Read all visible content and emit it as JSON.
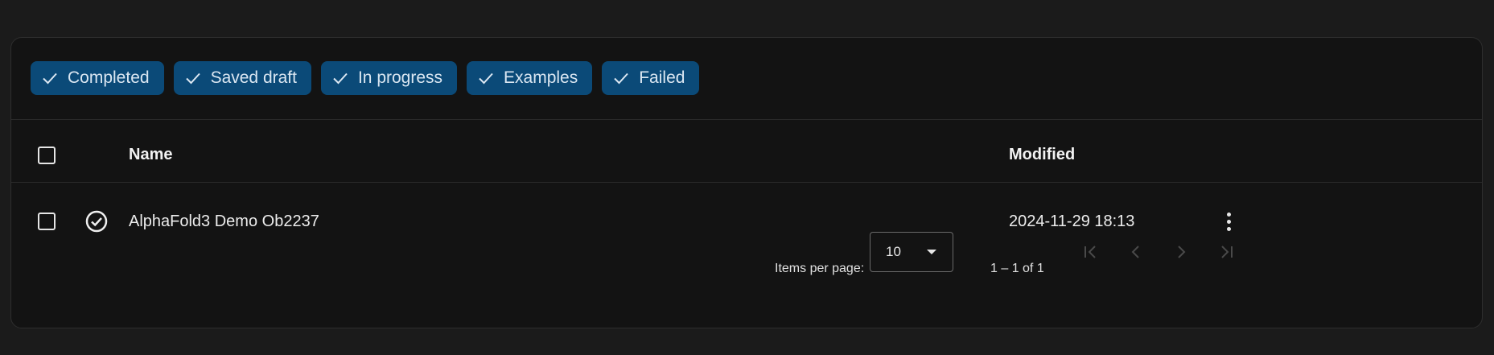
{
  "filters": [
    {
      "label": "Completed",
      "icon": "check-icon"
    },
    {
      "label": "Saved draft",
      "icon": "check-icon"
    },
    {
      "label": "In progress",
      "icon": "check-icon"
    },
    {
      "label": "Examples",
      "icon": "check-icon"
    },
    {
      "label": "Failed",
      "icon": "check-icon"
    }
  ],
  "table": {
    "columns": {
      "name": "Name",
      "modified": "Modified"
    },
    "rows": [
      {
        "status_icon": "check-circle-icon",
        "name": "AlphaFold3 Demo Ob2237",
        "modified": "2024-11-29 18:13",
        "menu_icon": "more-vert-icon"
      }
    ]
  },
  "paginator": {
    "items_per_page_label": "Items per page:",
    "items_per_page_value": "10",
    "range_label": "1 – 1 of 1",
    "buttons": [
      "first-page-icon",
      "previous-page-icon",
      "next-page-icon",
      "last-page-icon"
    ]
  },
  "colors": {
    "background": "#1b1b1b",
    "panel": "#131313",
    "chip": "#0b4a78",
    "text": "#e8e8e8",
    "disabled": "#4a4a4a"
  }
}
